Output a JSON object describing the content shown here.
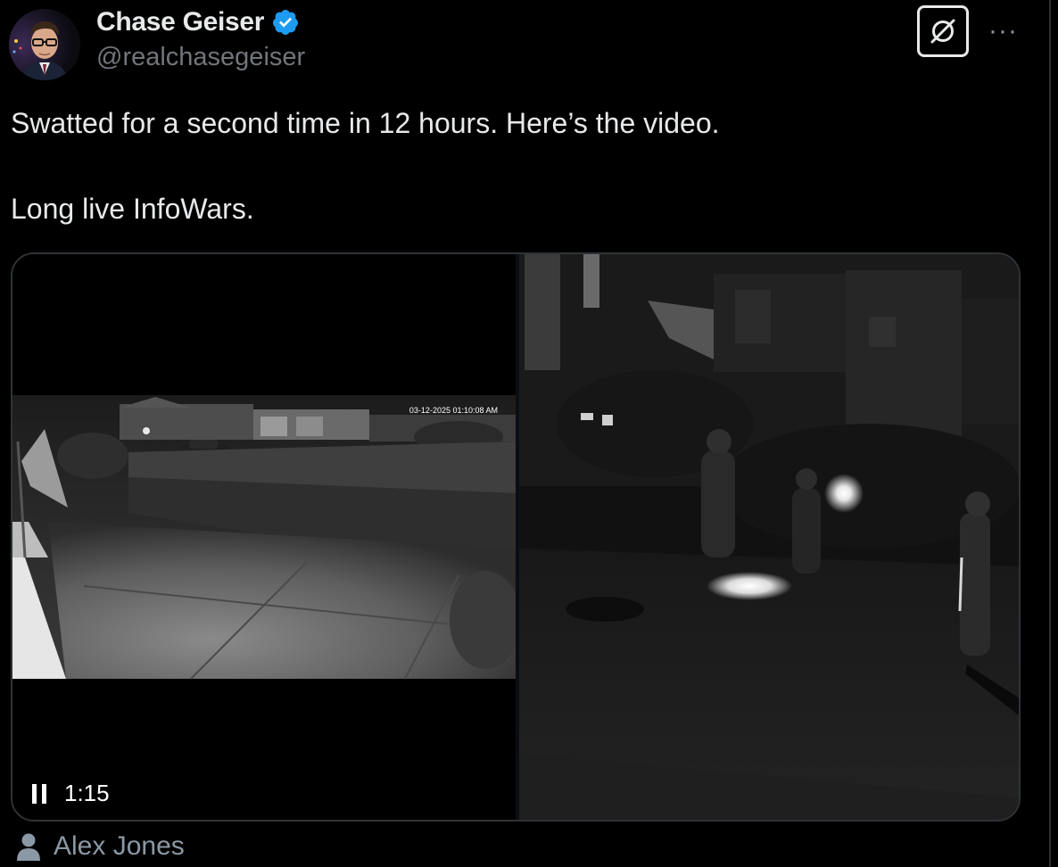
{
  "author": {
    "display_name": "Chase Geiser",
    "handle": "@realchasegeiser",
    "verified_icon": "verified-badge-icon",
    "verified_color": "#1d9bf0"
  },
  "actions": {
    "grok_icon": "grok-icon",
    "more_label": "···"
  },
  "tweet": {
    "lines": [
      "Swatted for a second time in 12 hours. Here’s the video.",
      "Long live InfoWars."
    ]
  },
  "video": {
    "camera_timestamp": "03-12-2025 01:10:08 AM",
    "elapsed": "1:15",
    "state_icon": "pause-icon"
  },
  "media_credit": {
    "icon": "person-icon",
    "name": "Alex Jones"
  }
}
